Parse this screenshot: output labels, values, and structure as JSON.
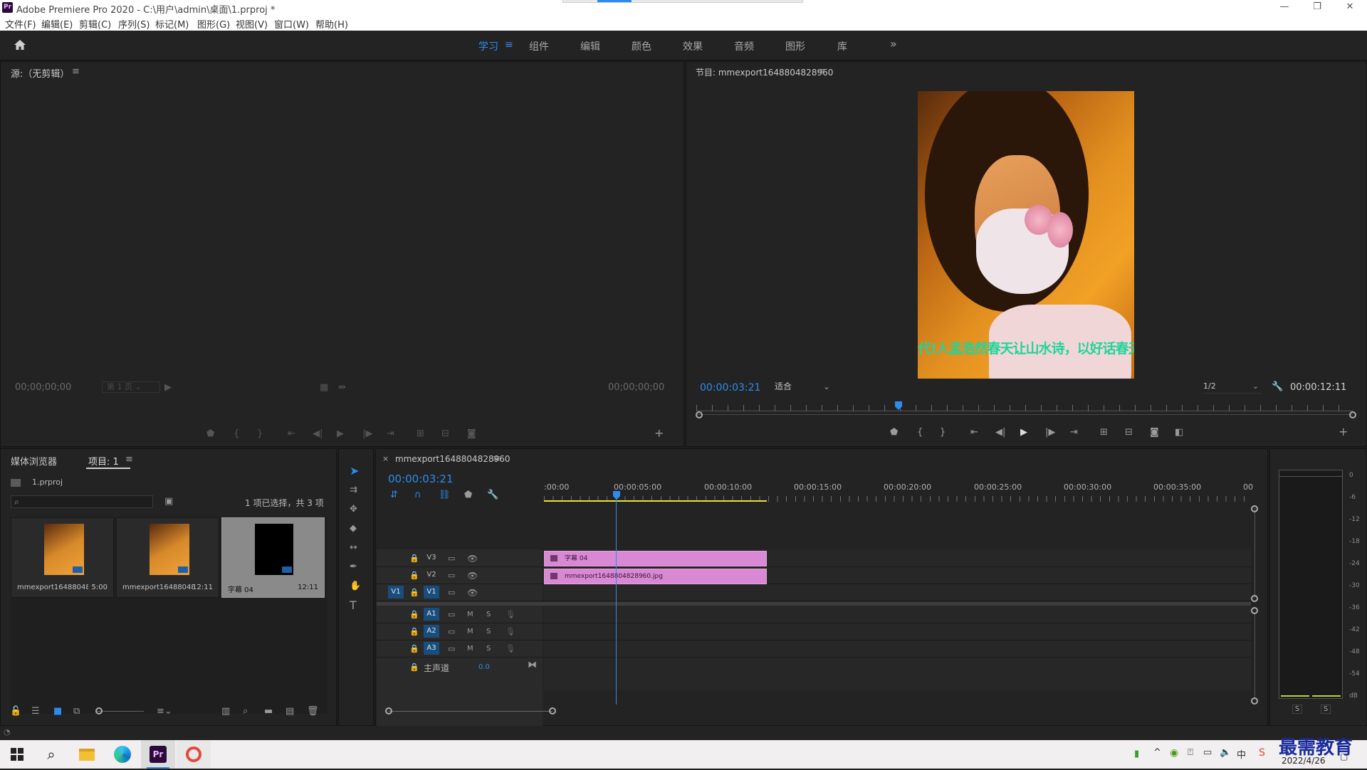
{
  "window": {
    "title": "Adobe Premiere Pro 2020 - C:\\用户\\admin\\桌面\\1.prproj *",
    "app_icon": "Pr"
  },
  "menu": [
    "文件(F)",
    "编辑(E)",
    "剪辑(C)",
    "序列(S)",
    "标记(M)",
    "图形(G)",
    "视图(V)",
    "窗口(W)",
    "帮助(H)"
  ],
  "workspaces": [
    "学习",
    "组件",
    "编辑",
    "颜色",
    "效果",
    "音频",
    "图形",
    "库"
  ],
  "source": {
    "title": "源:（无剪辑）",
    "tc_left": "00;00;00;00",
    "page": "第 1 页",
    "tc_right": "00;00;00;00"
  },
  "program": {
    "title": "节目: mmexport1648804828960",
    "tc_current": "00:00:03:21",
    "fit": "适合",
    "quality": "1/2",
    "tc_duration": "00:00:12:11",
    "subtitle": "代!人孟浩然春天让山水诗，以好话春天的!春天，好暮光"
  },
  "project": {
    "tab_media": "媒体浏览器",
    "tab_project": "项目: 1",
    "file": "1.prproj",
    "selection": "1 项已选择，共 3 项",
    "items": [
      {
        "name": "mmexport1648804828...",
        "duration": "5:00"
      },
      {
        "name": "mmexport1648804828...",
        "duration": "12:11"
      },
      {
        "name": "字幕 04",
        "duration": "12:11"
      }
    ]
  },
  "timeline": {
    "sequence": "mmexport1648804828960",
    "tc": "00:00:03:21",
    "ruler": [
      ":00:00",
      "00:00:05:00",
      "00:00:10:00",
      "00:00:15:00",
      "00:00:20:00",
      "00:00:25:00",
      "00:00:30:00",
      "00:00:35:00",
      "00"
    ],
    "video_tracks": [
      "V3",
      "V2",
      "V1"
    ],
    "audio_tracks": [
      "A1",
      "A2",
      "A3"
    ],
    "source_patch": "V1",
    "master": "主声道",
    "master_value": "0.0",
    "clip_v3": "字幕 04",
    "clip_v2": "mmexport1648804828960.jpg",
    "mute": "M",
    "solo": "S"
  },
  "meter": {
    "scale": [
      "0",
      "-6",
      "-12",
      "-18",
      "-24",
      "-30",
      "-36",
      "-42",
      "-48",
      "-54",
      "dB"
    ],
    "solo_l": "S",
    "solo_r": "S"
  },
  "taskbar": {
    "date": "2022/4/26",
    "watermark": "最需教育"
  }
}
